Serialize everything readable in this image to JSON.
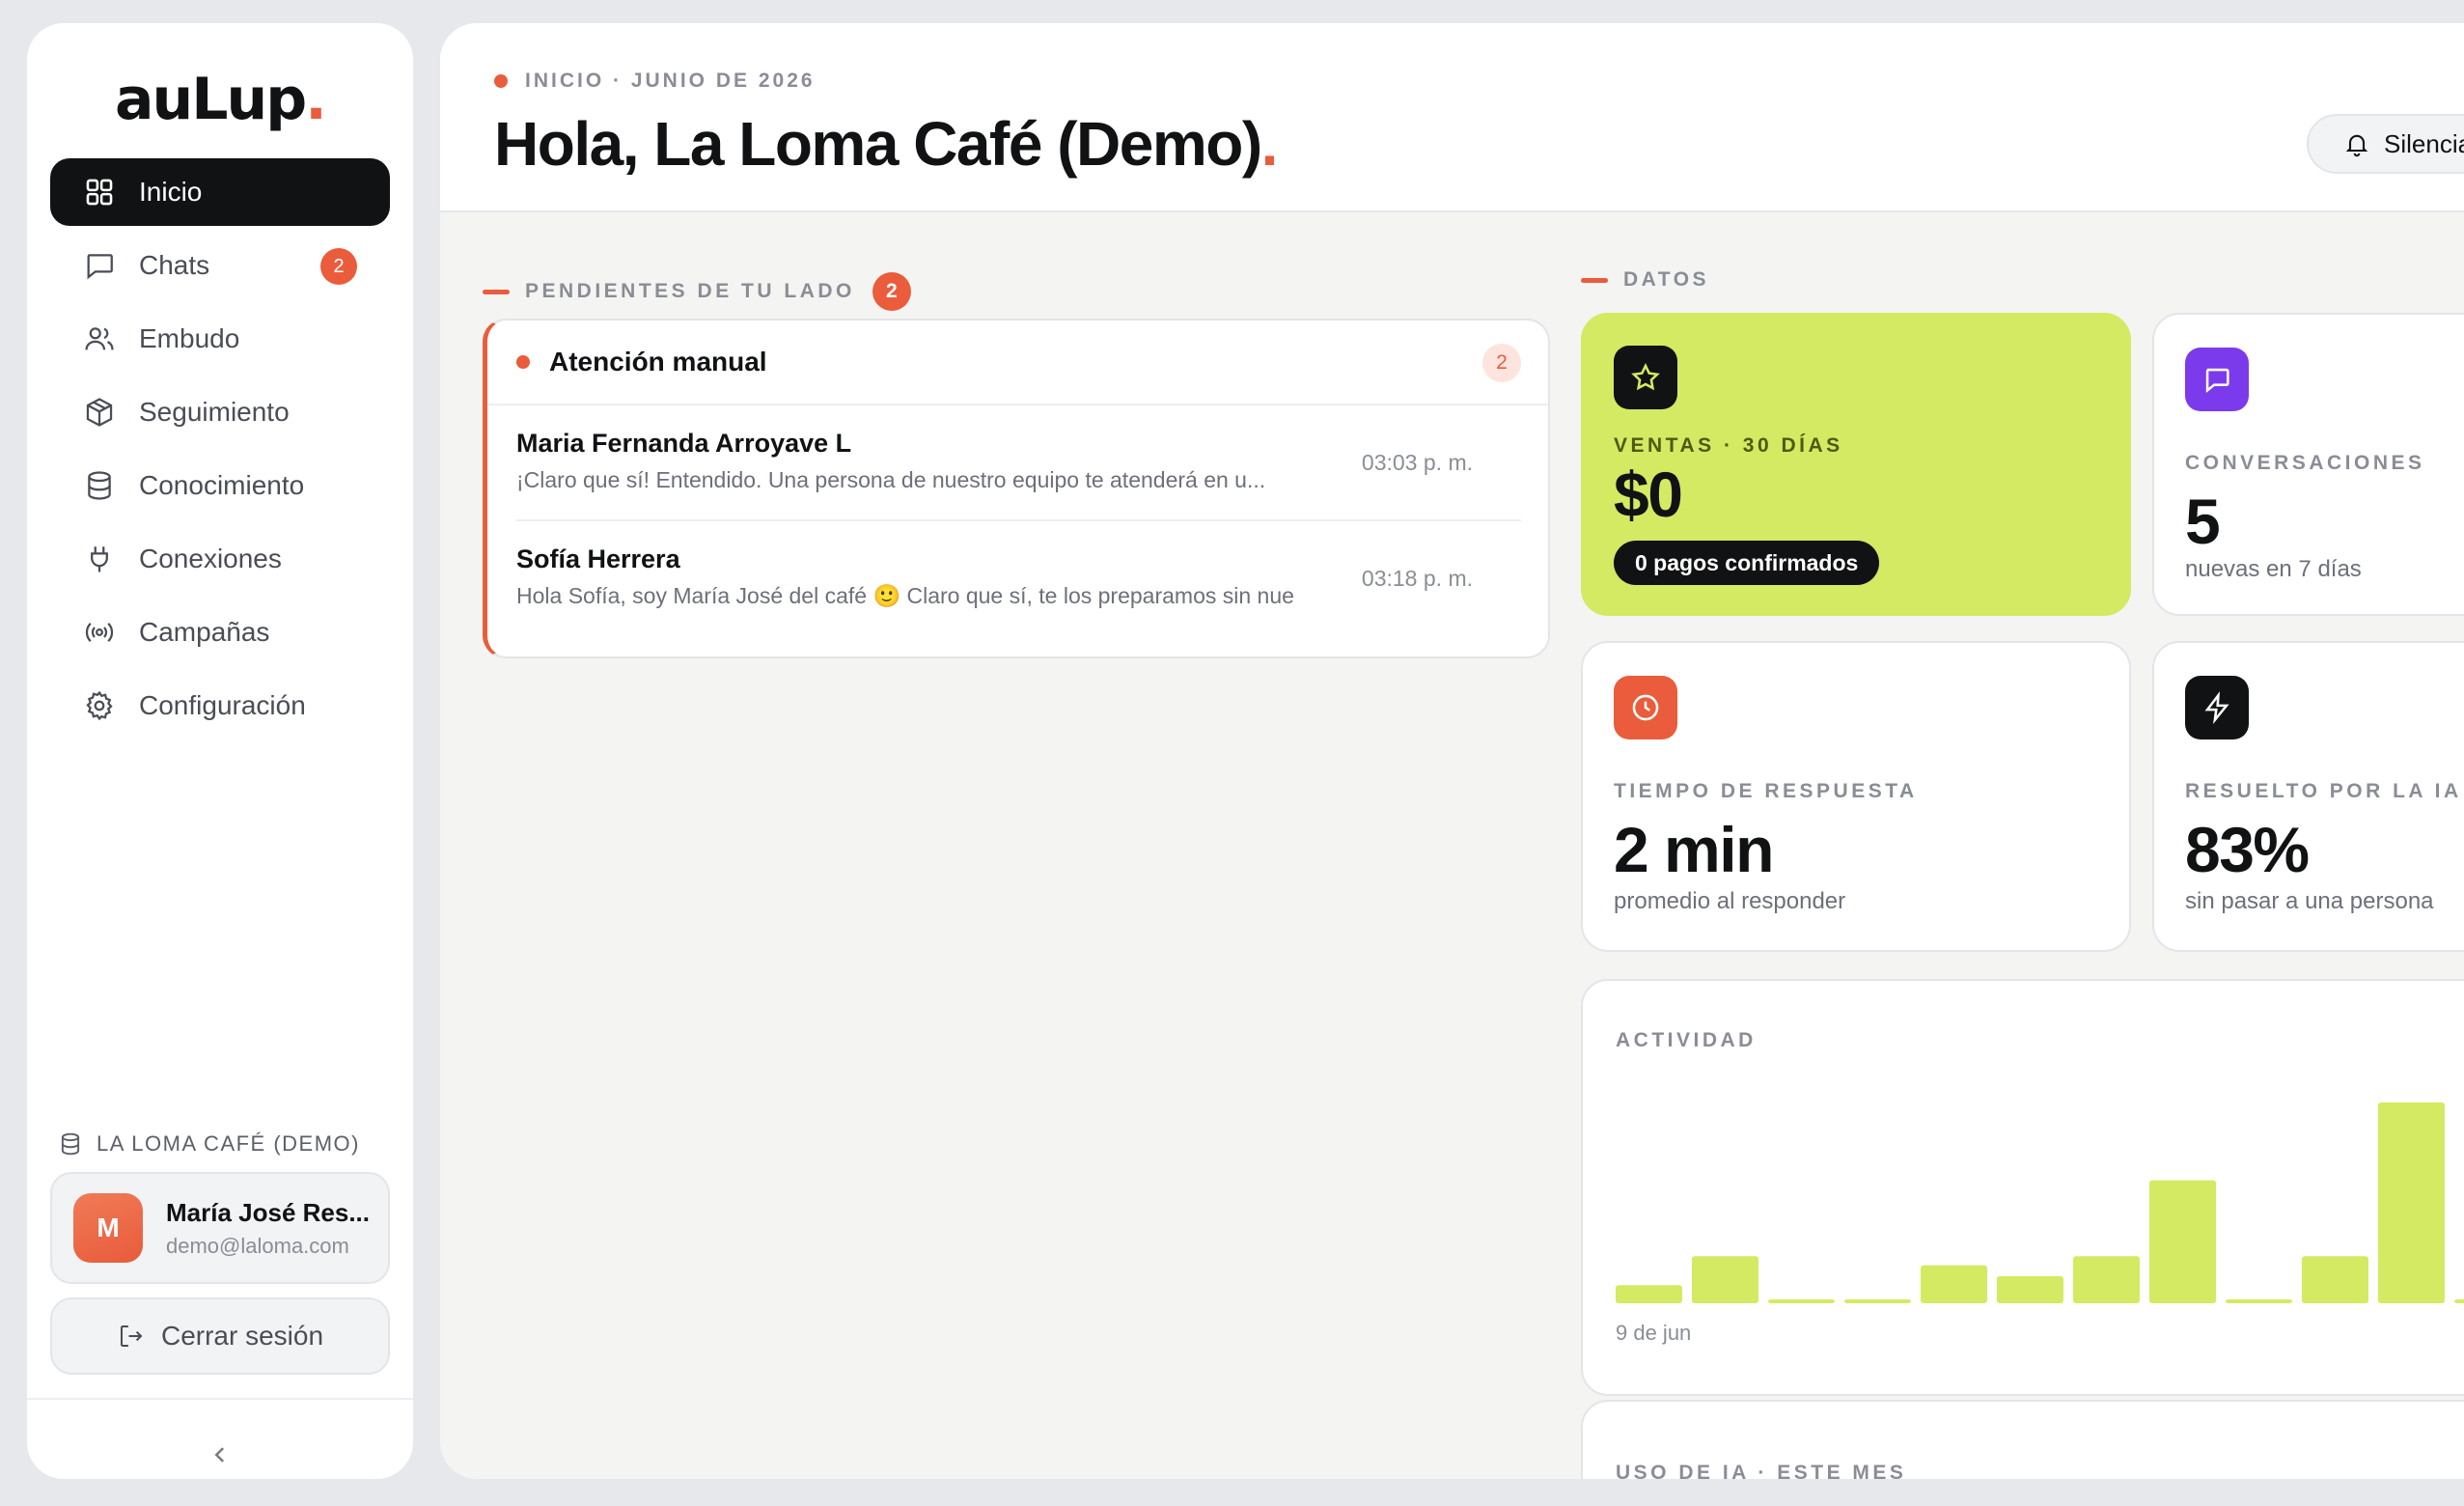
{
  "app": {
    "logo_text": "auLup",
    "logo_dot": "."
  },
  "sidebar": {
    "items": [
      {
        "label": "Inicio",
        "icon": "grid-icon",
        "active": true
      },
      {
        "label": "Chats",
        "icon": "chat-icon",
        "badge": "2"
      },
      {
        "label": "Embudo",
        "icon": "users-icon"
      },
      {
        "label": "Seguimiento",
        "icon": "box-icon"
      },
      {
        "label": "Conocimiento",
        "icon": "database-icon"
      },
      {
        "label": "Conexiones",
        "icon": "plug-icon"
      },
      {
        "label": "Campañas",
        "icon": "broadcast-icon"
      },
      {
        "label": "Configuración",
        "icon": "gear-icon"
      }
    ],
    "org_name": "LA LOMA CAFÉ (DEMO)",
    "user": {
      "initial": "M",
      "name": "María José Res...",
      "email": "demo@laloma.com"
    },
    "logout_label": "Cerrar sesión",
    "collapse_icon": "chevron-left-icon"
  },
  "header": {
    "breadcrumb": "INICIO · JUNIO DE 2026",
    "title": "Hola, La Loma Café (Demo)",
    "title_dot": ".",
    "silence_label": "Silenciar"
  },
  "pending": {
    "section_label": "PENDIENTES DE TU LADO",
    "count": "2",
    "card_title": "Atención manual",
    "card_count": "2",
    "chats": [
      {
        "name": "Maria Fernanda Arroyave L",
        "preview": "¡Claro que sí! Entendido. Una persona de nuestro equipo te atenderá en u...",
        "time": "03:03 p. m."
      },
      {
        "name": "Sofía Herrera",
        "preview": "Hola Sofía, soy María José del café 🙂 Claro que sí, te los preparamos sin nue",
        "time": "03:18 p. m."
      }
    ]
  },
  "datos": {
    "section_label": "DATOS",
    "ventas": {
      "label": "VENTAS · 30 DÍAS",
      "value": "$0",
      "pill": "0 pagos confirmados",
      "icon": "star-icon"
    },
    "conversaciones": {
      "label": "CONVERSACIONES",
      "value": "5",
      "sub": "nuevas en 7 días",
      "icon": "message-icon"
    },
    "respuesta": {
      "label": "TIEMPO DE RESPUESTA",
      "value": "2 min",
      "sub": "promedio al responder",
      "icon": "clock-icon"
    },
    "ia": {
      "label": "RESUELTO POR LA IA",
      "value": "83%",
      "sub": "sin pasar a una persona",
      "icon": "bolt-icon"
    }
  },
  "activity": {
    "title": "ACTIVIDAD",
    "start_label": "9 de jun"
  },
  "ia_usage": {
    "title": "USO DE IA · ESTE MES"
  },
  "chart_data": {
    "type": "bar",
    "title": "ACTIVIDAD",
    "values": [
      1,
      2.6,
      0.2,
      0.2,
      2.1,
      1.5,
      2.6,
      6.8,
      0.2,
      2.6,
      11.1,
      0.2
    ],
    "ylim": [
      0,
      11.1
    ],
    "grid": false,
    "color": "#d4ea62"
  },
  "colors": {
    "accent": "#ea5c3b",
    "lime": "#d4ea62",
    "purple": "#7c3aed",
    "dark": "#111214"
  }
}
